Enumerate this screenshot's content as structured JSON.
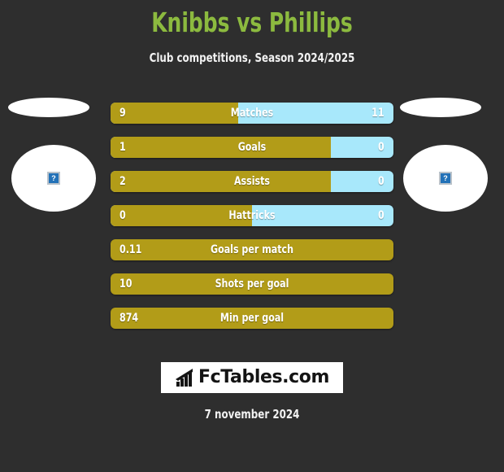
{
  "header": {
    "title": "Knibbs vs Phillips",
    "subtitle": "Club competitions, Season 2024/2025",
    "title_color": "#8cba3f"
  },
  "colors": {
    "background": "#2e2e2e",
    "home_bar": "#b29c18",
    "away_bar": "#a8e8fb",
    "text": "#ffffff"
  },
  "players": {
    "left": {
      "name": "Knibbs",
      "photo_status": "missing",
      "placeholder_icon": "broken-image-icon",
      "placeholder_glyph": "?"
    },
    "right": {
      "name": "Phillips",
      "photo_status": "missing",
      "placeholder_icon": "broken-image-icon",
      "placeholder_glyph": "?"
    }
  },
  "chart_data": {
    "type": "bar",
    "title": "Knibbs vs Phillips",
    "subtitle": "Club competitions, Season 2024/2025",
    "orientation": "horizontal-diverging",
    "grid": false,
    "legend": "none",
    "series": [
      {
        "name": "Knibbs",
        "color": "#b29c18",
        "side": "left"
      },
      {
        "name": "Phillips",
        "color": "#a8e8fb",
        "side": "right"
      }
    ],
    "categories": [
      "Matches",
      "Goals",
      "Assists",
      "Hattricks",
      "Goals per match",
      "Shots per goal",
      "Min per goal"
    ],
    "rows": [
      {
        "label": "Matches",
        "left_value": "9",
        "right_value": "11",
        "left_pct": 45,
        "single": false
      },
      {
        "label": "Goals",
        "left_value": "1",
        "right_value": "0",
        "left_pct": 78,
        "single": false
      },
      {
        "label": "Assists",
        "left_value": "2",
        "right_value": "0",
        "left_pct": 78,
        "single": false
      },
      {
        "label": "Hattricks",
        "left_value": "0",
        "right_value": "0",
        "left_pct": 50,
        "single": false
      },
      {
        "label": "Goals per match",
        "left_value": "0.11",
        "right_value": "",
        "left_pct": 100,
        "single": true
      },
      {
        "label": "Shots per goal",
        "left_value": "10",
        "right_value": "",
        "left_pct": 100,
        "single": true
      },
      {
        "label": "Min per goal",
        "left_value": "874",
        "right_value": "",
        "left_pct": 100,
        "single": true
      }
    ]
  },
  "footer": {
    "logo_text": "FcTables.com",
    "logo_icon": "bar-chart-icon",
    "date": "7 november 2024"
  }
}
